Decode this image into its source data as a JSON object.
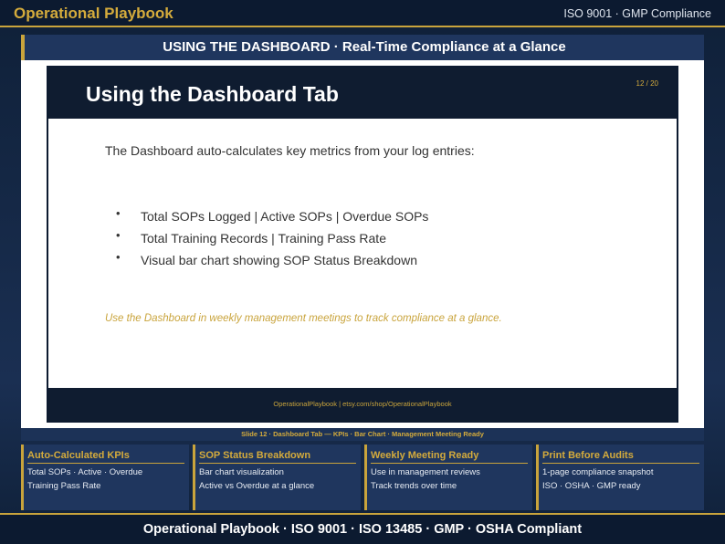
{
  "header": {
    "brand": "Operational Playbook",
    "standard": "ISO 9001 · GMP Compliance"
  },
  "banner": {
    "text": "USING THE DASHBOARD  ·  Real-Time Compliance at a Glance"
  },
  "slide": {
    "title": "Using the Dashboard Tab",
    "page": "12 / 20",
    "intro": "The Dashboard auto-calculates key metrics from your log entries:",
    "bullets": [
      "Total SOPs Logged | Active SOPs | Overdue SOPs",
      "Total Training Records | Training Pass Rate",
      "Visual bar chart showing SOP Status Breakdown"
    ],
    "tip": "Use the Dashboard in weekly management meetings to track compliance at a glance.",
    "footer": "OperationalPlaybook | etsy.com/shop/OperationalPlaybook"
  },
  "caption": "Slide 12 · Dashboard Tab — KPIs · Bar Chart · Management Meeting Ready",
  "cards": [
    {
      "title": "Auto-Calculated KPIs",
      "line1": "Total SOPs · Active · Overdue",
      "line2": "Training Pass Rate"
    },
    {
      "title": "SOP Status Breakdown",
      "line1": "Bar chart visualization",
      "line2": "Active vs Overdue at a glance"
    },
    {
      "title": "Weekly Meeting Ready",
      "line1": "Use in management reviews",
      "line2": "Track trends over time"
    },
    {
      "title": "Print Before Audits",
      "line1": "1-page compliance snapshot",
      "line2": "ISO · OSHA · GMP ready"
    }
  ],
  "footer": {
    "text": "Operational Playbook  ·  ISO 9001  ·  ISO 13485  ·  GMP  ·  OSHA Compliant"
  },
  "colors": {
    "accent": "#c9a43c",
    "navy": "#0f1c30",
    "panel": "#1f365e"
  }
}
